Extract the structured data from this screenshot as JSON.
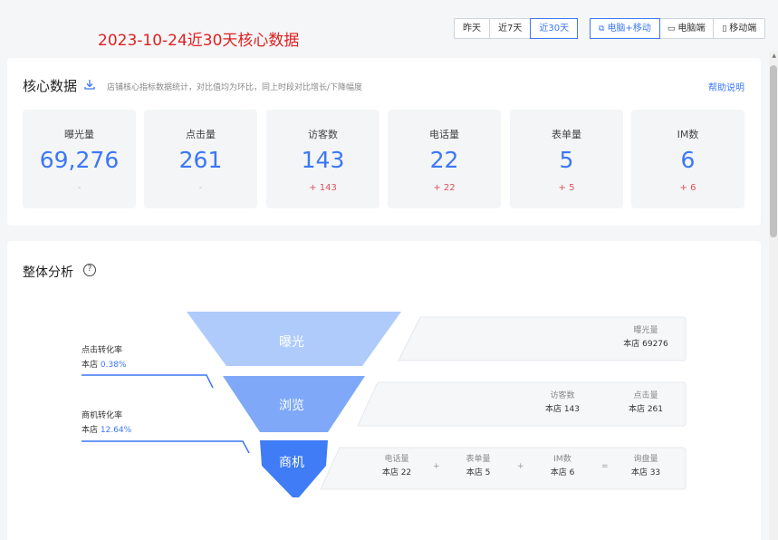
{
  "header": {
    "title": "2023-10-24近30天核心数据",
    "date_ranges": [
      "昨天",
      "近7天",
      "近30天"
    ],
    "active_range": "近30天",
    "devices": [
      "电脑+移动",
      "电脑端",
      "移动端"
    ],
    "active_device": "电脑+移动"
  },
  "core": {
    "title": "核心数据",
    "description": "店铺核心指标数据统计，对比值均为环比，同上时段对比增长/下降幅度",
    "help": "帮助说明",
    "metrics": [
      {
        "label": "曝光量",
        "value": "69,276",
        "change": "-"
      },
      {
        "label": "点击量",
        "value": "261",
        "change": "-"
      },
      {
        "label": "访客数",
        "value": "143",
        "change": "+ 143"
      },
      {
        "label": "电话量",
        "value": "22",
        "change": "+ 22"
      },
      {
        "label": "表单量",
        "value": "5",
        "change": "+ 5"
      },
      {
        "label": "IM数",
        "value": "6",
        "change": "+ 6"
      }
    ]
  },
  "analysis": {
    "title": "整体分析",
    "help_icon": "?",
    "stages": [
      "曝光",
      "浏览",
      "商机"
    ],
    "click_rate": {
      "label": "点击转化率",
      "prefix": "本店",
      "value": "0.38%"
    },
    "biz_rate": {
      "label": "商机转化率",
      "prefix": "本店",
      "value": "12.64%"
    },
    "exposure": {
      "name": "曝光量",
      "value": "本店 69276"
    },
    "browse": [
      {
        "name": "访客数",
        "value": "本店 143"
      },
      {
        "name": "点击量",
        "value": "本店 261"
      }
    ],
    "biz": [
      {
        "name": "电话量",
        "value": "本店 22"
      },
      {
        "name": "表单量",
        "value": "本店 5"
      },
      {
        "name": "IM数",
        "value": "本店 6"
      },
      {
        "name": "询盘量",
        "value": "本店 33"
      }
    ],
    "ops": [
      "+",
      "+",
      "="
    ]
  },
  "colors": {
    "accent": "#3b77f6",
    "heading_red": "#e02020",
    "stage1": "#aecbfb",
    "stage2": "#7fa9f8",
    "stage3": "#3f7cf5"
  }
}
